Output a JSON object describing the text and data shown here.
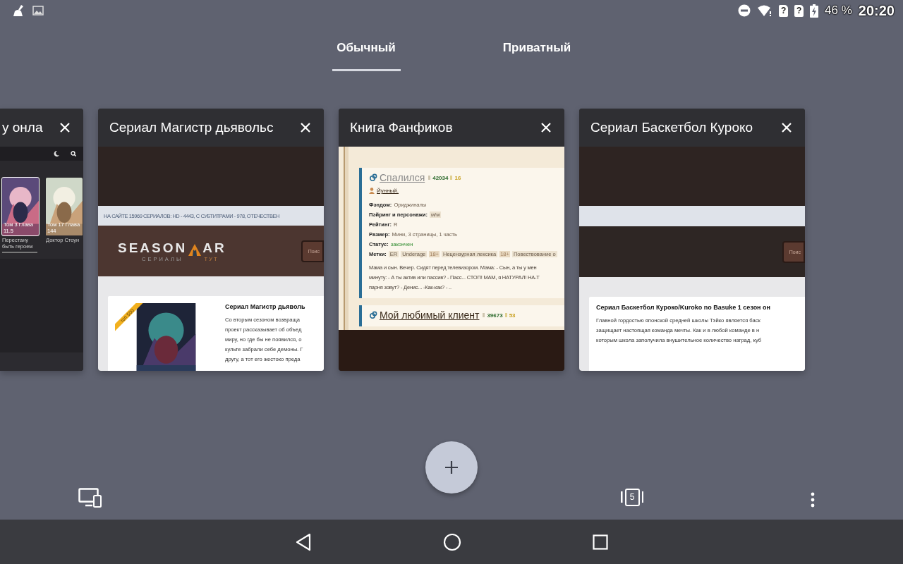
{
  "status_bar": {
    "sims": [
      "?",
      "?"
    ],
    "battery": "46 %",
    "time": "20:20"
  },
  "tabs": [
    {
      "label": "Обычный",
      "selected": true
    },
    {
      "label": "Приватный",
      "selected": false
    }
  ],
  "cards": [
    {
      "kind": "manga",
      "offscreen_left": true,
      "title": "у онла",
      "covers": [
        {
          "caption": "Том 3 Глава 11.5",
          "name": "Перестану быть героем"
        },
        {
          "caption": "Том 17 Глава 144",
          "name": "Доктор Стоун"
        }
      ]
    },
    {
      "kind": "series",
      "title": "Сериал Магистр дьявольс",
      "banner": "НА САЙТЕ 15969 СЕРИАЛОВ: HD - 4443, С СУБТИТРАМИ - 978, ОТЕЧЕСТВЕН",
      "logo": {
        "start": "SEASON",
        "end": "AR",
        "sub_start": "СЕРИАЛЫ",
        "sub_end": "ТУТ"
      },
      "search_button": "Поис",
      "poster": true,
      "ribbon": "топ 500",
      "heading": "Сериал Магистр дьяволь",
      "lines": [
        "Со вторым сезоном возвраща",
        "проект рассказывает об объед",
        "миру, но где бы не появился, о",
        "культе забрали себе демоны. Г",
        "другу, а тот его жестоко преда"
      ]
    },
    {
      "kind": "fanfic",
      "title": "Книга Фанфиков",
      "stories": [
        {
          "title": "Спалился",
          "visited": true,
          "views": "42034",
          "likes": "16",
          "author": "Йунный.",
          "fields": [
            {
              "label": "Фэндом:",
              "value": "Ориджиналы",
              "kind": "text"
            },
            {
              "label": "Пэйринг и персонажи:",
              "value": "м/м",
              "kind": "chip"
            },
            {
              "label": "Рейтинг:",
              "value": "R",
              "kind": "text"
            },
            {
              "label": "Размер:",
              "value": "Мини, 3 страницы, 1 часть",
              "kind": "text"
            },
            {
              "label": "Статус:",
              "value": "закончен",
              "kind": "status"
            }
          ],
          "tags_label": "Метки:",
          "tags": [
            {
              "label": "ER"
            },
            {
              "label": "Underage",
              "age": "18+"
            },
            {
              "label": "Нецензурная лексика",
              "age": "18+"
            },
            {
              "label": "Повествование о"
            }
          ],
          "lines": [
            "Мама и сын. Вечер. Сидят перед телевизором. Мама: - Сын, а ты у мен",
            "минуту: - А ты актив или пассив? - Пасс... СТОП! МАМ, я НАТУРАЛ! НА-Т",
            "парня зовут? - Денис... -Как-как? - .."
          ]
        },
        {
          "title": "Мой любимый клиент",
          "visited": false,
          "views": "39673",
          "likes": "53"
        }
      ]
    },
    {
      "kind": "series",
      "title": "Сериал Баскетбол Куроко",
      "search_button": "Поис",
      "heading": "Сериал Баскетбол Куроко/Kuroko no Basuke 1 сезон он",
      "lines": [
        "Главной гордостью японской средней школы Тэйко является баск",
        "защищает настоящая команда мечты. Как и в любой команде в н",
        "которым школа заполучила внушительное количество наград, куб"
      ]
    }
  ],
  "tab_count": "5"
}
